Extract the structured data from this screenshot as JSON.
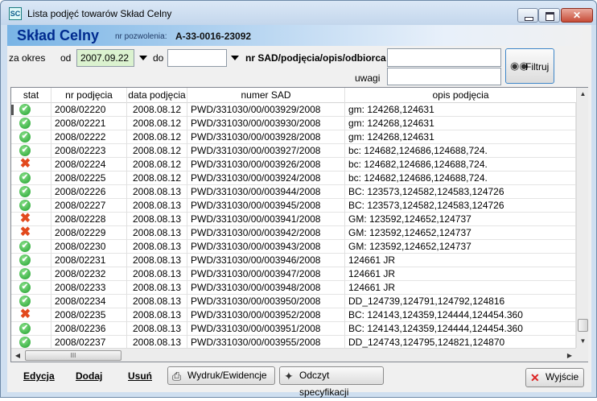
{
  "window": {
    "title": "Lista podjęć towarów Skład Celny",
    "icon_text": "SC"
  },
  "header": {
    "brand": "Skład Celny",
    "permit_label": "nr pozwolenia:",
    "permit_value": "A-33-0016-23092"
  },
  "filters": {
    "za_okres_label": "za okres",
    "od_label": "od",
    "from_date": "2007.09.22",
    "do_label": "do",
    "to_date": "",
    "sad_label": "nr SAD/podjęcia/opis/odbiorca",
    "sad_value": "",
    "uwagi_label": "uwagi",
    "uwagi_value": "",
    "filter_button": "Filtruj"
  },
  "table": {
    "columns": [
      "stat",
      "nr podjęcia",
      "data podjęcia",
      "numer SAD",
      "opis podjęcia"
    ],
    "rows": [
      {
        "status": "ok",
        "nr": "2008/02220",
        "date": "2008.08.12",
        "sad": "PWD/331030/00/003929/2008",
        "opis": "gm: 124268,124631"
      },
      {
        "status": "ok",
        "nr": "2008/02221",
        "date": "2008.08.12",
        "sad": "PWD/331030/00/003930/2008",
        "opis": "gm: 124268,124631"
      },
      {
        "status": "ok",
        "nr": "2008/02222",
        "date": "2008.08.12",
        "sad": "PWD/331030/00/003928/2008",
        "opis": "gm: 124268,124631"
      },
      {
        "status": "ok",
        "nr": "2008/02223",
        "date": "2008.08.12",
        "sad": "PWD/331030/00/003927/2008",
        "opis": "bc: 124682,124686,124688,724."
      },
      {
        "status": "error",
        "nr": "2008/02224",
        "date": "2008.08.12",
        "sad": "PWD/331030/00/003926/2008",
        "opis": "bc: 124682,124686,124688,724."
      },
      {
        "status": "ok",
        "nr": "2008/02225",
        "date": "2008.08.12",
        "sad": "PWD/331030/00/003924/2008",
        "opis": "bc: 124682,124686,124688,724."
      },
      {
        "status": "ok",
        "nr": "2008/02226",
        "date": "2008.08.13",
        "sad": "PWD/331030/00/003944/2008",
        "opis": "BC: 123573,124582,124583,124726"
      },
      {
        "status": "ok",
        "nr": "2008/02227",
        "date": "2008.08.13",
        "sad": "PWD/331030/00/003945/2008",
        "opis": "BC: 123573,124582,124583,124726"
      },
      {
        "status": "error",
        "nr": "2008/02228",
        "date": "2008.08.13",
        "sad": "PWD/331030/00/003941/2008",
        "opis": "GM: 123592,124652,124737"
      },
      {
        "status": "error",
        "nr": "2008/02229",
        "date": "2008.08.13",
        "sad": "PWD/331030/00/003942/2008",
        "opis": "GM: 123592,124652,124737"
      },
      {
        "status": "ok",
        "nr": "2008/02230",
        "date": "2008.08.13",
        "sad": "PWD/331030/00/003943/2008",
        "opis": "GM: 123592,124652,124737"
      },
      {
        "status": "ok",
        "nr": "2008/02231",
        "date": "2008.08.13",
        "sad": "PWD/331030/00/003946/2008",
        "opis": " 124661 JR"
      },
      {
        "status": "ok",
        "nr": "2008/02232",
        "date": "2008.08.13",
        "sad": "PWD/331030/00/003947/2008",
        "opis": " 124661 JR"
      },
      {
        "status": "ok",
        "nr": "2008/02233",
        "date": "2008.08.13",
        "sad": "PWD/331030/00/003948/2008",
        "opis": " 124661 JR"
      },
      {
        "status": "ok",
        "nr": "2008/02234",
        "date": "2008.08.13",
        "sad": "PWD/331030/00/003950/2008",
        "opis": "DD_124739,124791,124792,124816"
      },
      {
        "status": "error",
        "nr": "2008/02235",
        "date": "2008.08.13",
        "sad": "PWD/331030/00/003952/2008",
        "opis": "BC: 124143,124359,124444,124454.360"
      },
      {
        "status": "ok",
        "nr": "2008/02236",
        "date": "2008.08.13",
        "sad": "PWD/331030/00/003951/2008",
        "opis": "BC: 124143,124359,124444,124454.360"
      },
      {
        "status": "ok",
        "nr": "2008/02237",
        "date": "2008.08.13",
        "sad": "PWD/331030/00/003955/2008",
        "opis": "DD_124743,124795,124821,124870"
      }
    ]
  },
  "actions": {
    "edit": "Edycja",
    "add": "Dodaj",
    "delete": "Usuń",
    "print": "Wydruk/Ewidencje",
    "read_spec": "Odczyt specyfikacji",
    "exit": "Wyjście"
  },
  "scrollbar": {
    "h_thumb_grip": "III"
  }
}
